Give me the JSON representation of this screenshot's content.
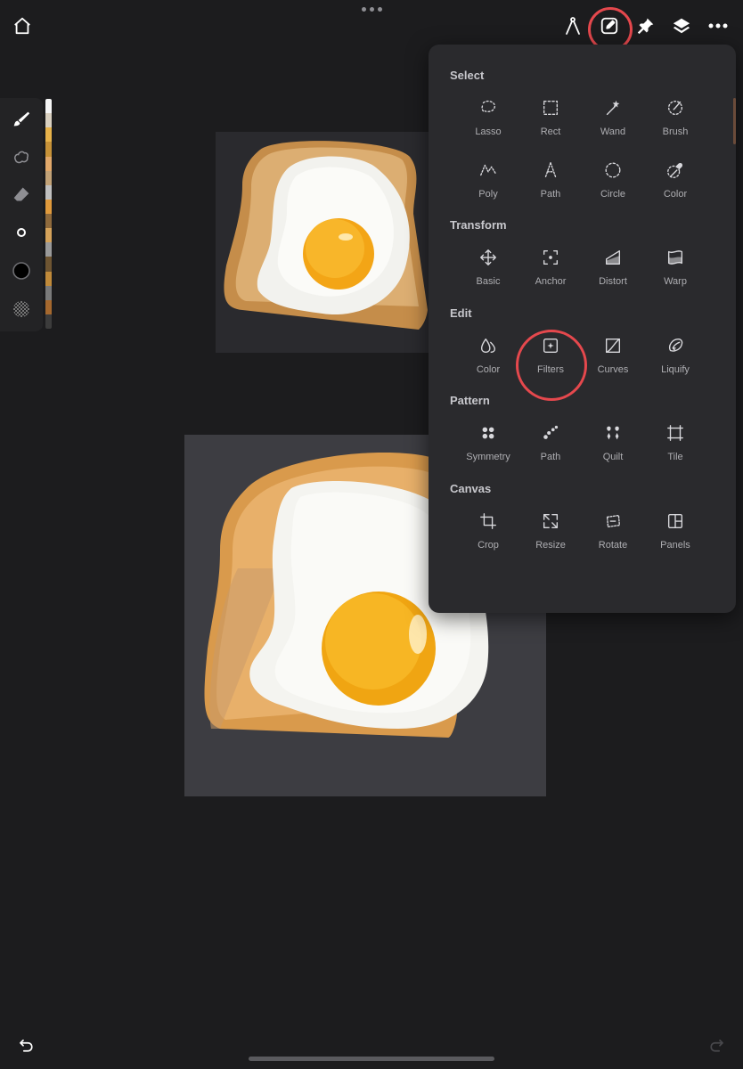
{
  "toolbar": {
    "home_icon": "home-icon",
    "right_icons": [
      "compass-icon",
      "edit-square-icon",
      "pin-icon",
      "layers-icon",
      "more-icon"
    ]
  },
  "left_toolbar": {
    "tools": [
      "brush-icon",
      "smudge-icon",
      "eraser-icon",
      "brush-size-icon",
      "color-circle-icon",
      "opacity-icon"
    ],
    "palette": [
      "#f5f5f5",
      "#d9d0c0",
      "#e7b24a",
      "#c79238",
      "#e1a86a",
      "#c2a277",
      "#bfbfbf",
      "#e09a3c",
      "#8f6a3c",
      "#d4a25a",
      "#9a9a9a",
      "#6e5532",
      "#c08a3a",
      "#7a7a7a",
      "#a5682e",
      "#3c3c3c"
    ]
  },
  "panel": {
    "sections": [
      {
        "title": "Select",
        "tools": [
          {
            "label": "Lasso",
            "icon": "lasso-icon"
          },
          {
            "label": "Rect",
            "icon": "rect-select-icon"
          },
          {
            "label": "Wand",
            "icon": "wand-icon"
          },
          {
            "label": "Brush",
            "icon": "brush-select-icon"
          },
          {
            "label": "Poly",
            "icon": "poly-select-icon"
          },
          {
            "label": "Path",
            "icon": "path-select-icon"
          },
          {
            "label": "Circle",
            "icon": "circle-select-icon"
          },
          {
            "label": "Color",
            "icon": "color-select-icon"
          }
        ]
      },
      {
        "title": "Transform",
        "tools": [
          {
            "label": "Basic",
            "icon": "move-icon"
          },
          {
            "label": "Anchor",
            "icon": "anchor-icon"
          },
          {
            "label": "Distort",
            "icon": "distort-icon"
          },
          {
            "label": "Warp",
            "icon": "warp-icon"
          }
        ]
      },
      {
        "title": "Edit",
        "tools": [
          {
            "label": "Color",
            "icon": "color-drops-icon"
          },
          {
            "label": "Filters",
            "icon": "filters-icon"
          },
          {
            "label": "Curves",
            "icon": "curves-icon"
          },
          {
            "label": "Liquify",
            "icon": "liquify-icon"
          }
        ]
      },
      {
        "title": "Pattern",
        "tools": [
          {
            "label": "Symmetry",
            "icon": "symmetry-icon"
          },
          {
            "label": "Path",
            "icon": "pattern-path-icon"
          },
          {
            "label": "Quilt",
            "icon": "quilt-icon"
          },
          {
            "label": "Tile",
            "icon": "tile-icon"
          }
        ]
      },
      {
        "title": "Canvas",
        "tools": [
          {
            "label": "Crop",
            "icon": "crop-icon"
          },
          {
            "label": "Resize",
            "icon": "resize-icon"
          },
          {
            "label": "Rotate",
            "icon": "rotate-icon"
          },
          {
            "label": "Panels",
            "icon": "panels-icon"
          }
        ]
      }
    ]
  },
  "bottom": {
    "undo_icon": "undo-icon",
    "redo_icon": "redo-icon"
  },
  "colors": {
    "background": "#1c1c1e",
    "panel": "#2a2a2d",
    "highlight_ring": "#e5484d"
  }
}
